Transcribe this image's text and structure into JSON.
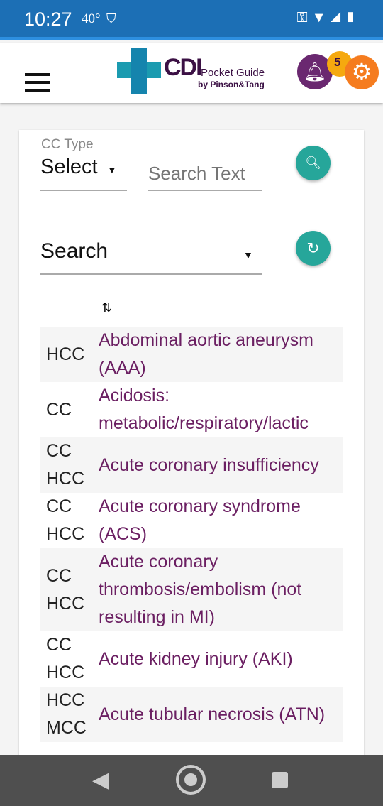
{
  "status_bar": {
    "time": "10:27",
    "temperature": "40°"
  },
  "app_bar": {
    "logo_text": "CDI",
    "logo_sub": "Pocket Guide",
    "logo_by": "by Pinson&Tang",
    "notification_count": "5"
  },
  "filters": {
    "cc_type_label": "CC Type",
    "cc_type_value": "Select",
    "search_placeholder": "Search Text",
    "search_dropdown_value": "Search"
  },
  "colors": {
    "accent": "#26a69a",
    "link": "#6b1f62",
    "status_bar": "#1c6fb5"
  },
  "rows": [
    {
      "type": "HCC",
      "name": "Abdominal aortic aneurysm (AAA)"
    },
    {
      "type": "CC",
      "name": "Acidosis: metabolic/respiratory/lactic"
    },
    {
      "type": "CC HCC",
      "name": "Acute coronary insufficiency"
    },
    {
      "type": "CC HCC",
      "name": "Acute coronary syndrome (ACS)"
    },
    {
      "type": "CC HCC",
      "name": "Acute coronary thrombosis/embolism (not resulting in MI)"
    },
    {
      "type": "CC HCC",
      "name": "Acute kidney injury (AKI)"
    },
    {
      "type": "HCC MCC",
      "name": "Acute tubular necrosis (ATN)"
    }
  ]
}
